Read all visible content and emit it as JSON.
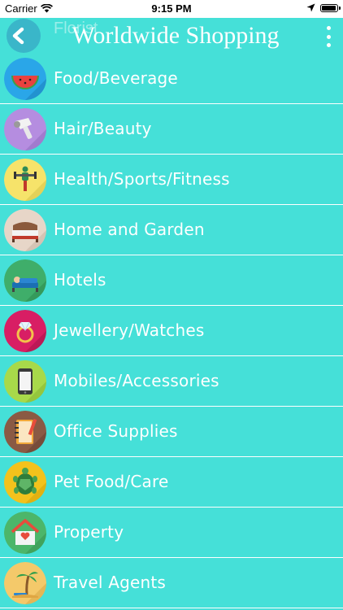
{
  "status_bar": {
    "carrier": "Carrier",
    "time": "9:15 PM",
    "battery_level": 0.95
  },
  "nav": {
    "title": "Worldwide Shopping",
    "ghost_title": "Florist",
    "back_icon": "chevron-left-icon",
    "menu_icon": "more-vertical-icon"
  },
  "categories": [
    {
      "label": "Food/Beverage",
      "icon": "watermelon-icon",
      "color": "#2aa6e8"
    },
    {
      "label": "Hair/Beauty",
      "icon": "hairdryer-icon",
      "color": "#b58de0"
    },
    {
      "label": "Health/Sports/Fitness",
      "icon": "fitness-icon",
      "color": "#f6e36a"
    },
    {
      "label": "Home and Garden",
      "icon": "bed-icon",
      "color": "#e7d6c8"
    },
    {
      "label": "Hotels",
      "icon": "hotel-bed-icon",
      "color": "#3fae6a"
    },
    {
      "label": "Jewellery/Watches",
      "icon": "ring-icon",
      "color": "#d81e64"
    },
    {
      "label": "Mobiles/Accessories",
      "icon": "mobile-phone-icon",
      "color": "#a8d94a"
    },
    {
      "label": "Office Supplies",
      "icon": "notebook-icon",
      "color": "#8a5a44"
    },
    {
      "label": "Pet Food/Care",
      "icon": "turtle-icon",
      "color": "#f3c21c"
    },
    {
      "label": "Property",
      "icon": "house-icon",
      "color": "#4cb66a"
    },
    {
      "label": "Travel Agents",
      "icon": "palm-beach-icon",
      "color": "#f4c96a"
    }
  ]
}
